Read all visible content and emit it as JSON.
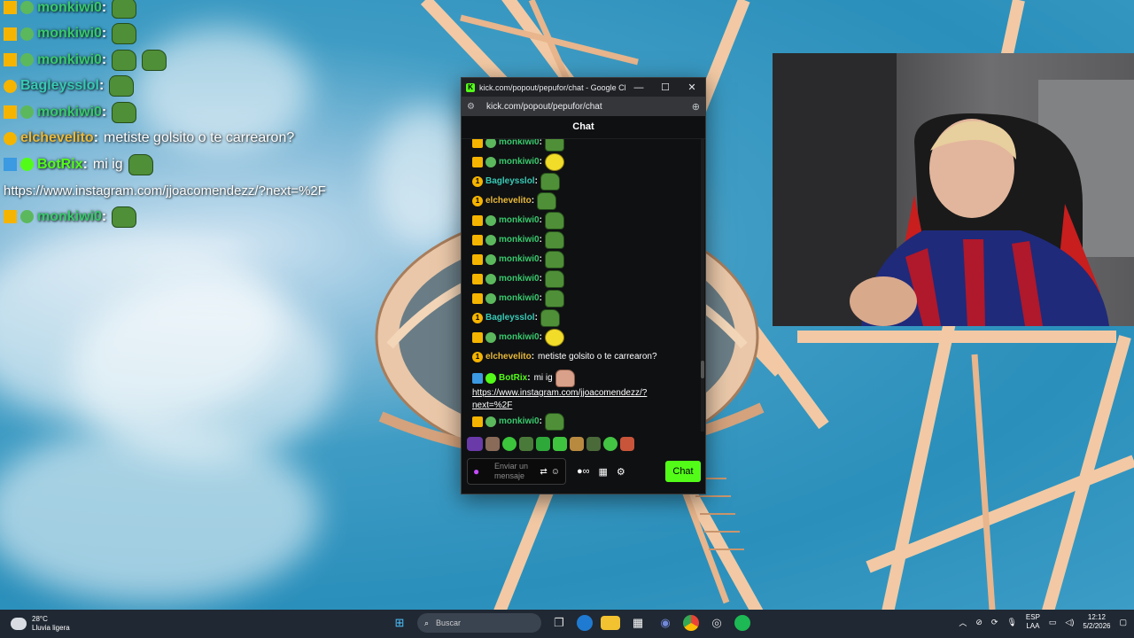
{
  "overlay": {
    "rows": [
      {
        "user": "monkiwi0",
        "color": "#38c96c",
        "badges": [
          "crown",
          "frog"
        ],
        "emotes": 1
      },
      {
        "user": "monkiwi0",
        "color": "#38c96c",
        "badges": [
          "crown",
          "frog"
        ],
        "emotes": 1
      },
      {
        "user": "monkiwi0",
        "color": "#38c96c",
        "badges": [
          "crown",
          "frog"
        ],
        "emotes": 2
      },
      {
        "user": "Bagleysslol",
        "color": "#38c9b5",
        "badges": [
          "one"
        ],
        "emotes": 1
      },
      {
        "user": "monkiwi0",
        "color": "#38c96c",
        "badges": [
          "crown",
          "frog"
        ],
        "emotes": 1
      },
      {
        "user": "elchevelito",
        "color": "#e8b93a",
        "badges": [
          "one"
        ],
        "message": "metiste golsito o te carrearon?"
      },
      {
        "user": "BotRix",
        "color": "#53fc18",
        "badges": [
          "bot",
          "verified"
        ],
        "message": "mi ig",
        "emotes": 1
      },
      {
        "link": "https://www.instagram.com/jjoacomendezz/?next=%2F"
      },
      {
        "user": "monkiwi0",
        "color": "#38c96c",
        "badges": [
          "crown",
          "frog"
        ],
        "emotes": 1
      }
    ]
  },
  "window": {
    "title": "kick.com/popout/pepufor/chat - Google Chr...",
    "url": "kick.com/popout/pepufor/chat",
    "minimize": "—",
    "maximize": "☐",
    "close": "✕",
    "chat_header": "Chat",
    "messages": [
      {
        "user": "monkiwi0",
        "color": "#38c96c",
        "badges": [
          "crown",
          "frog"
        ],
        "emote": "green"
      },
      {
        "user": "monkiwi0",
        "color": "#38c96c",
        "badges": [
          "crown",
          "frog"
        ],
        "emote": "yellow"
      },
      {
        "user": "Bagleysslol",
        "color": "#38c9b5",
        "badges": [
          "one"
        ],
        "emote": "green"
      },
      {
        "user": "elchevelito",
        "color": "#e8b93a",
        "badges": [
          "one"
        ],
        "emote": "green"
      },
      {
        "user": "monkiwi0",
        "color": "#38c96c",
        "badges": [
          "crown",
          "frog"
        ],
        "emote": "green"
      },
      {
        "user": "monkiwi0",
        "color": "#38c96c",
        "badges": [
          "crown",
          "frog"
        ],
        "emote": "green"
      },
      {
        "user": "monkiwi0",
        "color": "#38c96c",
        "badges": [
          "crown",
          "frog"
        ],
        "emote": "green"
      },
      {
        "user": "monkiwi0",
        "color": "#38c96c",
        "badges": [
          "crown",
          "frog"
        ],
        "emote": "green"
      },
      {
        "user": "monkiwi0",
        "color": "#38c96c",
        "badges": [
          "crown",
          "frog"
        ],
        "emote": "green"
      },
      {
        "user": "Bagleysslol",
        "color": "#38c9b5",
        "badges": [
          "one"
        ],
        "emote": "green"
      },
      {
        "user": "monkiwi0",
        "color": "#38c96c",
        "badges": [
          "crown",
          "frog"
        ],
        "emote": "yellow"
      },
      {
        "user": "elchevelito",
        "color": "#e8b93a",
        "badges": [
          "one"
        ],
        "message": "metiste golsito o te carrearon?"
      },
      {
        "user": "BotRix",
        "color": "#53fc18",
        "badges": [
          "bot",
          "verified"
        ],
        "message": "mi ig",
        "link": "https://www.instagram.com/jjoacomendezz/?next=%2F"
      },
      {
        "user": "monkiwi0",
        "color": "#38c96c",
        "badges": [
          "crown",
          "frog"
        ],
        "emote": "green"
      }
    ],
    "input_placeholder": "Enviar un mensaje",
    "send_label": "Chat"
  },
  "taskbar": {
    "temperature": "28°C",
    "weather": "Lluvia ligera",
    "search_placeholder": "Buscar",
    "lang_top": "ESP",
    "lang_bottom": "LAA",
    "time": "12:12",
    "date": "5/2/2026"
  }
}
